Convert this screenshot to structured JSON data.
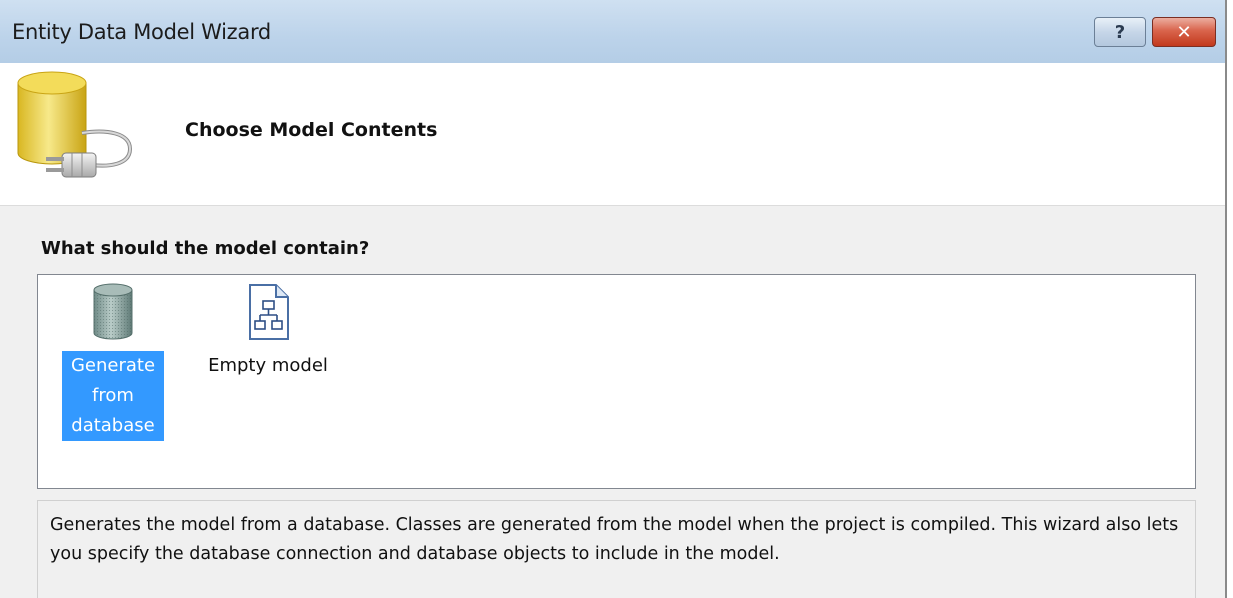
{
  "window": {
    "title": "Entity Data Model Wizard",
    "help_label": "?",
    "close_label": "✕"
  },
  "header": {
    "heading": "Choose Model Contents",
    "icon": "database-plug-icon"
  },
  "content": {
    "question": "What should the model contain?",
    "options": [
      {
        "label": "Generate from database",
        "icon": "database-icon",
        "selected": true
      },
      {
        "label": "Empty model",
        "icon": "diagram-document-icon",
        "selected": false
      }
    ],
    "description": "Generates the model from a database. Classes are generated from the model when the project is compiled. This wizard also lets you specify the database connection and database objects to include in the model."
  },
  "colors": {
    "selection": "#3399ff",
    "title_bar": "#c4d8ee",
    "close_button": "#d2543a"
  }
}
